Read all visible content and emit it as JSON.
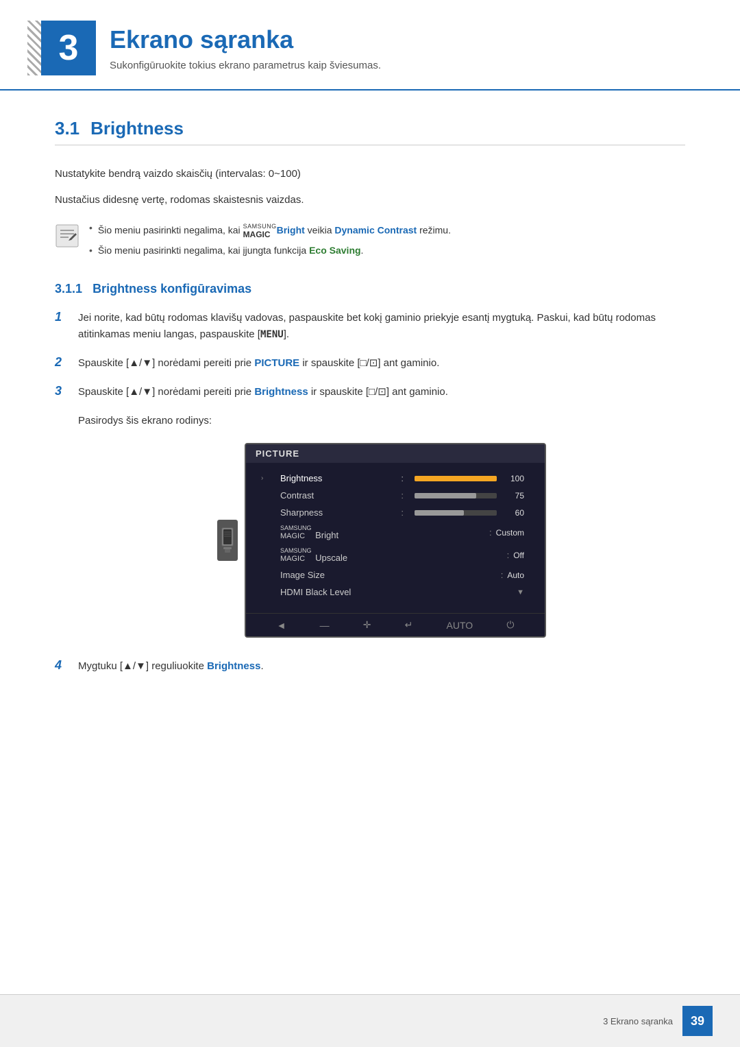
{
  "header": {
    "chapter_number": "3",
    "chapter_title": "Ekrano sąranka",
    "chapter_subtitle": "Sukonfigūruokite tokius ekrano parametrus kaip šviesumas.",
    "decorative_pattern": "diagonal-lines"
  },
  "section": {
    "number": "3.1",
    "title": "Brightness",
    "body1": "Nustatykite bendrą vaizdo skaisčių (intervalas: 0~100)",
    "body2": "Nustačius didesnę vertę, rodomas skaistesnis vaizdas.",
    "notes": [
      {
        "text_prefix": "Šio meniu pasirinkti negalima, kai ",
        "brand": "SAMSUNG MAGIC",
        "highlight_word": "Bright",
        "text_middle": " veikia ",
        "highlight2": "Dynamic Contrast",
        "text_suffix": " režimu."
      },
      {
        "text_prefix": "Šio meniu pasirinkti negalima, kai įjungta funkcija ",
        "highlight_word": "Eco Saving",
        "text_suffix": "."
      }
    ]
  },
  "subsection": {
    "number": "3.1.1",
    "title": "Brightness konfigūravimas"
  },
  "steps": [
    {
      "number": "1",
      "text": "Jei norite, kad būtų rodomas klavišų vadovas, paspauskite bet kokį gaminio priekyje esantį mygtuką. Paskui, kad būtų rodomas atitinkamas meniu langas, paspauskite [",
      "key": "MENU",
      "text_after": "]."
    },
    {
      "number": "2",
      "text_prefix": "Spauskite [▲/▼] norėdami pereiti prie ",
      "highlight": "PICTURE",
      "text_middle": " ir spauskite [□/⊡] ant gaminio."
    },
    {
      "number": "3",
      "text_prefix": "Spauskite [▲/▼] norėdami pereiti prie ",
      "highlight": "Brightness",
      "text_middle": " ir spauskite [□/⊡] ant gaminio.",
      "note": "Pasirodys šis ekrano rodinys:"
    },
    {
      "number": "4",
      "text_prefix": "Mygtuku [▲/▼] reguliuokite ",
      "highlight": "Brightness",
      "text_suffix": "."
    }
  ],
  "monitor_menu": {
    "title": "PICTURE",
    "items": [
      {
        "label": "Brightness",
        "type": "bar",
        "bar_percent": 100,
        "value": "100",
        "active": true
      },
      {
        "label": "Contrast",
        "type": "bar",
        "bar_percent": 75,
        "value": "75",
        "active": false
      },
      {
        "label": "Sharpness",
        "type": "bar",
        "bar_percent": 60,
        "value": "60",
        "active": false
      },
      {
        "label": "SAMSUNG MAGIC Bright",
        "type": "text",
        "value": "Custom",
        "active": false
      },
      {
        "label": "SAMSUNG MAGIC Upscale",
        "type": "text",
        "value": "Off",
        "active": false
      },
      {
        "label": "Image Size",
        "type": "text",
        "value": "Auto",
        "active": false
      },
      {
        "label": "HDMI Black Level",
        "type": "none",
        "value": "",
        "active": false
      }
    ],
    "bottom_icons": [
      "◄",
      "—",
      "✛",
      "↵",
      "AUTO",
      "⏻"
    ]
  },
  "footer": {
    "chapter_name": "3 Ekrano sąranka",
    "page_number": "39"
  }
}
